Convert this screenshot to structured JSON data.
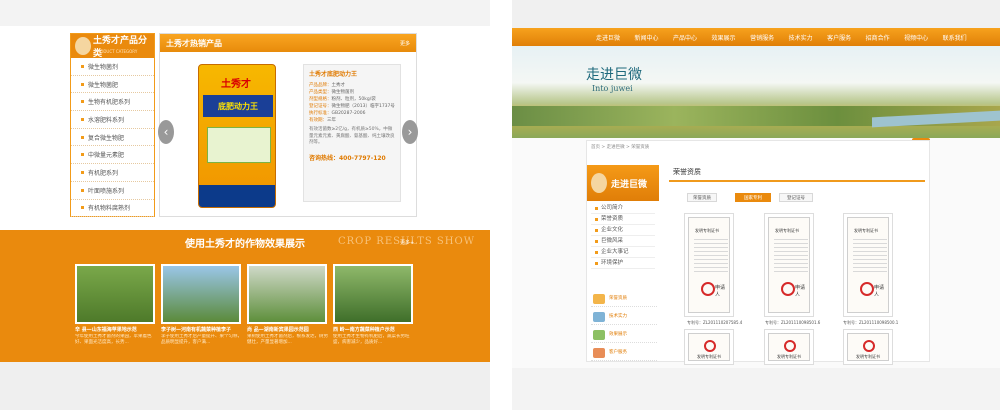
{
  "left": {
    "category": {
      "title": "土秀才产品分类",
      "subtitle": "PRODUCT CATEGORY",
      "items": [
        "微生物菌剂",
        "微生物菌肥",
        "生物有机肥系列",
        "水溶肥料系列",
        "复合微生物肥",
        "中微量元素肥",
        "有机肥系列",
        "叶面喷施系列",
        "有机物料腐熟剂"
      ]
    },
    "hot": {
      "title": "土秀才热销产品",
      "more": "更多",
      "bag_brand": "土秀才",
      "bag_band": "底肥动力王",
      "product_name": "土秀才底肥动力王",
      "rows": [
        {
          "k": "产品品牌：",
          "v": "土秀才"
        },
        {
          "k": "产品类型：",
          "v": "微生物菌剂"
        },
        {
          "k": "剂型规格：",
          "v": "粉剂、粒剂，50kg/袋"
        },
        {
          "k": "登记证号：",
          "v": "微生物肥（2013）临字1737号"
        },
        {
          "k": "执行标准：",
          "v": "GB20287-2006"
        },
        {
          "k": "有效期：",
          "v": "三年"
        }
      ],
      "desc": "有效活菌数≥2亿/g，有机质≥50%，中微量元素元素、黄腐酸、氨基酸、纯土壤改良剂等。",
      "phone": "咨询热线：400-7797-120",
      "prev": "‹",
      "next": "›"
    },
    "show": {
      "title": "使用土秀才的作物效果展示",
      "title_en": "CROP RESULTS SHOW",
      "more": "更多+",
      "photos": [
        {
          "caption": "辛 县—山东福海苹果地示范",
          "desc": "今年使用土秀才菌剂的果园，苹果着色好、果面光洁度高，长势..."
        },
        {
          "caption": "李子树—河南有机蔬菜种植李子",
          "desc": "李子使用土秀才后产量提升、果个匀称，品质明显提升，客户满..."
        },
        {
          "caption": "尚 品—湖南新宾果园示范园",
          "desc": "果树使用土秀才菌剂后，根系发达，树势健壮，产量显著增加..."
        },
        {
          "caption": "西 岭—南方蔬菜种植户示范",
          "desc": "使用土秀才生物有机肥后，蔬菜长势旺盛，病害减少，品质好..."
        }
      ]
    }
  },
  "right": {
    "nav": [
      "走进巨微",
      "新闻中心",
      "产品中心",
      "效果展示",
      "营销服务",
      "技术实力",
      "客户服务",
      "招商合作",
      "视频中心",
      "联系我们"
    ],
    "banner_title": "走进巨微",
    "banner_en": "Into juwei",
    "breadcrumb": "首页 > 走进巨微 > 荣誉资质",
    "home_badge": "首页",
    "side_title": "走进巨微",
    "side_items": [
      "公司简介",
      "荣誉资质",
      "企业文化",
      "巨微风采",
      "企业大事记",
      "环境保护"
    ],
    "mini_items": [
      "荣誉资质",
      "技术实力",
      "效果展示",
      "客户服务"
    ],
    "section_title": "荣誉资质",
    "tabs": [
      "荣誉资质",
      "国家专利",
      "登记证号"
    ],
    "certs": [
      {
        "title": "发明专利证书",
        "sign": "申请人",
        "cap": "专利号：ZL201110207585.4"
      },
      {
        "title": "发明专利证书",
        "sign": "申请人",
        "cap": "专利号：ZL201110098501.6"
      },
      {
        "title": "发明专利证书",
        "sign": "申请人",
        "cap": "专利号：ZL201110098500.1"
      }
    ],
    "certs_row2": [
      "发明专利证书",
      "发明专利证书",
      "发明专利证书"
    ]
  }
}
